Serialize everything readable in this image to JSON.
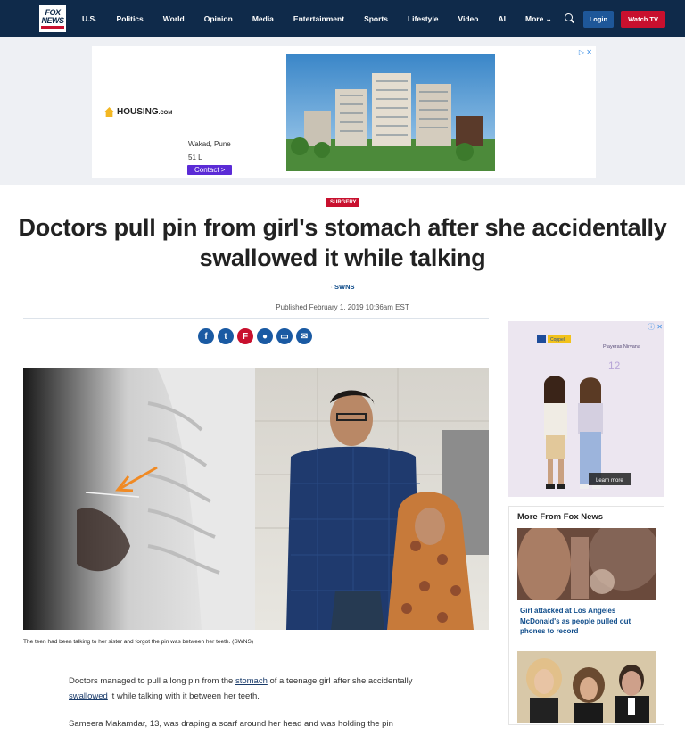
{
  "header": {
    "logo_line1": "FOX",
    "logo_line2": "NEWS",
    "nav": [
      "U.S.",
      "Politics",
      "World",
      "Opinion",
      "Media",
      "Entertainment",
      "Sports",
      "Lifestyle",
      "Video",
      "AI",
      "More ⌄"
    ],
    "login_label": "Login",
    "watch_label": "Watch TV"
  },
  "top_ad": {
    "brand": "HOUSING",
    "brand_suffix": ".COM",
    "location": "Wakad, Pune",
    "size": "51 L",
    "cta": "Contact >",
    "close": "▷ ✕"
  },
  "article": {
    "category": "SURGERY",
    "headline": "Doctors pull pin from girl's stomach after she accidentally swallowed it while talking",
    "byline_prefix": "· ",
    "byline": "SWNS",
    "published": "Published February 1, 2019 10:36am EST",
    "caption": "The teen had been talking to her sister and forgot the pin was between her teeth. (SWNS)",
    "para1_a": "Doctors managed to pull a long pin from the ",
    "para1_link1": "stomach",
    "para1_b": " of a teenage girl after she accidentally ",
    "para1_link2": "swallowed",
    "para1_c": " it while talking with it between her teeth.",
    "para2": "Sameera Makamdar, 13, was draping a scarf around her head and was holding the pin"
  },
  "share_icons": [
    "facebook-icon",
    "twitter-icon",
    "flipboard-icon",
    "comment-icon",
    "print-icon",
    "email-icon"
  ],
  "rail": {
    "ad_brand": "Coppel",
    "ad_text": "Playeras Nirvana",
    "ad_number": "12",
    "ad_cta": "Learn more",
    "ad_close": "ⓘ ✕",
    "more_title": "More From Fox News",
    "story1": "Girl attacked at Los Angeles McDonald's as people pulled out phones to record"
  },
  "colors": {
    "navy": "#0f2a4a",
    "red": "#c8102e",
    "link_blue": "#0f4c8a"
  }
}
